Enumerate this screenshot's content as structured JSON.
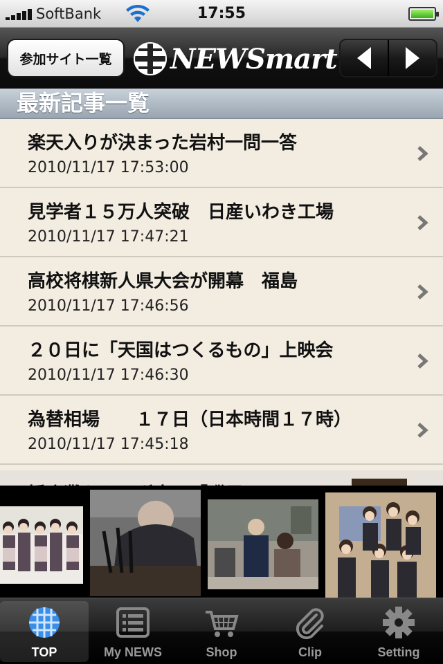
{
  "status_bar": {
    "carrier": "SoftBank",
    "time": "17:55",
    "signal_bars": 5,
    "battery_level": 1.0
  },
  "nav": {
    "sites_button_label": "参加サイト一覧",
    "logo_text": "NEWSmart"
  },
  "section": {
    "title": "最新記事一覧"
  },
  "articles": [
    {
      "title": "楽天入りが決まった岩村一問一答",
      "date": "2010/11/17 17:53:00"
    },
    {
      "title": "見学者１５万人突破　日産いわき工場",
      "date": "2010/11/17 17:47:21"
    },
    {
      "title": "高校将棋新人県大会が開幕　福島",
      "date": "2010/11/17 17:46:56"
    },
    {
      "title": "２０日に「天国はつくるもの」上映会",
      "date": "2010/11/17 17:46:30"
    },
    {
      "title": "為替相場　　１７日（日本時間１７時）",
      "date": "2010/11/17 17:45:18"
    },
    {
      "title": "播磨灘からこぎ出せ「磯風」",
      "date": ""
    }
  ],
  "tabs": [
    {
      "label": "TOP",
      "icon": "globe-icon",
      "active": true
    },
    {
      "label": "My NEWS",
      "icon": "list-icon",
      "active": false
    },
    {
      "label": "Shop",
      "icon": "cart-icon",
      "active": false
    },
    {
      "label": "Clip",
      "icon": "paperclip-icon",
      "active": false
    },
    {
      "label": "Setting",
      "icon": "gear-icon",
      "active": false
    }
  ],
  "colors": {
    "list_background": "#f2ece1",
    "section_header": "#a9b4bf",
    "tab_active_label": "#ffffff",
    "tab_inactive_label": "#9a9a9a"
  }
}
